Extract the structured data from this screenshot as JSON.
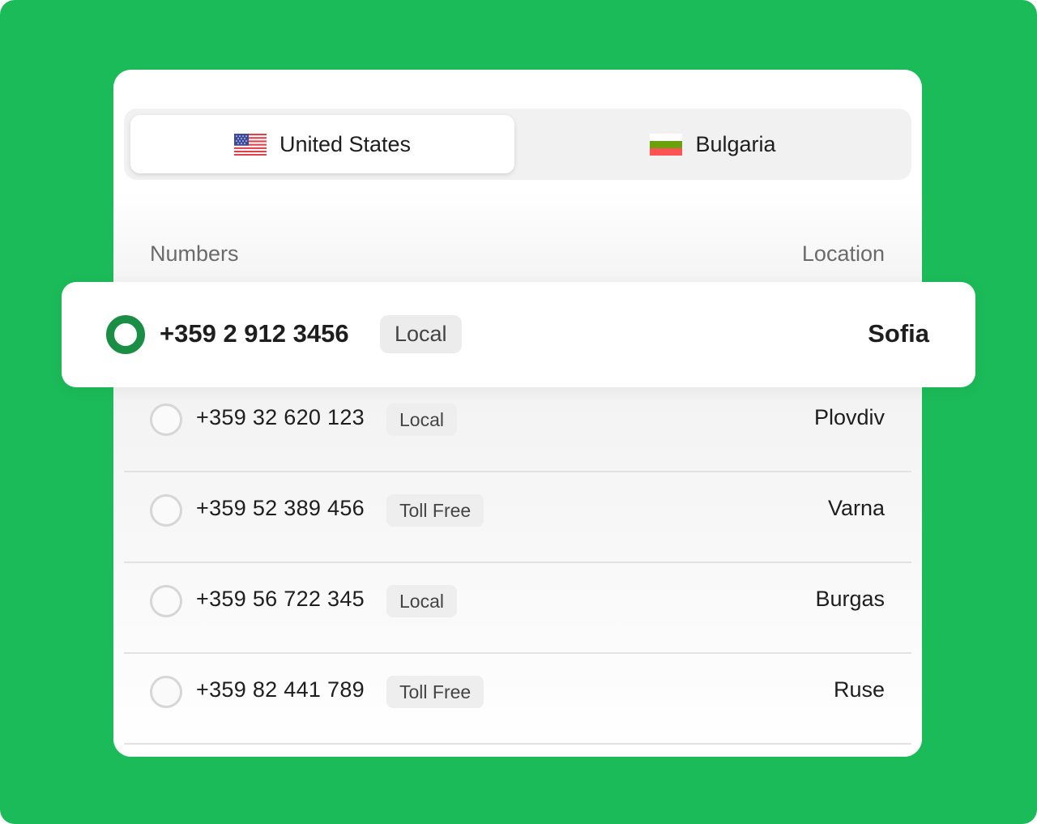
{
  "country_tabs": [
    {
      "label": "United States",
      "flag": "us-flag-icon",
      "selected": true
    },
    {
      "label": "Bulgaria",
      "flag": "bulgaria-flag-icon",
      "selected": false
    }
  ],
  "columns": {
    "numbers": "Numbers",
    "location": "Location"
  },
  "selected_row": {
    "number": "+359 2 912 3456",
    "type": "Local",
    "location": "Sofia"
  },
  "rows": [
    {
      "number": "+359 32 620 123",
      "type": "Local",
      "location": "Plovdiv"
    },
    {
      "number": "+359 52 389 456",
      "type": "Toll Free",
      "location": "Varna"
    },
    {
      "number": "+359 56 722 345",
      "type": "Local",
      "location": "Burgas"
    },
    {
      "number": "+359 82 441 789",
      "type": "Toll Free",
      "location": "Ruse"
    }
  ],
  "colors": {
    "background": "#1cbb59",
    "radio_selected": "#1b8e45",
    "bulgaria_flag": [
      "#ffffff",
      "#6aa20b",
      "#ff5252"
    ]
  }
}
